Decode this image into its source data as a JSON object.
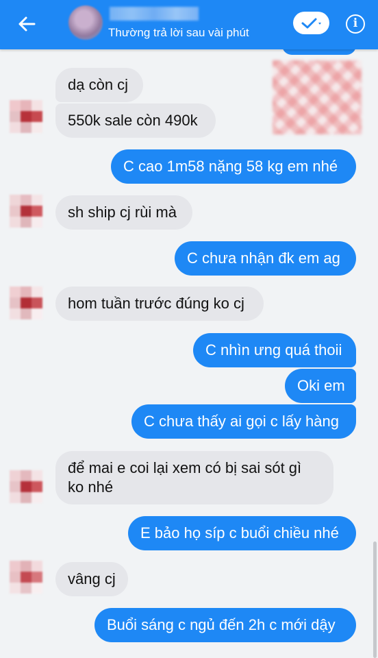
{
  "header": {
    "status_text": "Thường trả lời sau vài phút",
    "back_icon": "arrow-left-icon",
    "check_icon": "check-dropdown-icon",
    "info_icon": "info-icon",
    "info_glyph": "i"
  },
  "messages": [
    {
      "side": "in",
      "text": "dạ còn cj"
    },
    {
      "side": "in",
      "text": "550k sale còn 490k"
    },
    {
      "side": "out",
      "text": "C cao 1m58 nặng 58 kg em nhé"
    },
    {
      "side": "in",
      "text": "sh ship cj rùi mà"
    },
    {
      "side": "out",
      "text": "C chưa nhận đk em ag"
    },
    {
      "side": "in",
      "text": "hom tuần trước đúng ko cj"
    },
    {
      "side": "out",
      "text": "C nhìn ưng quá thoii"
    },
    {
      "side": "out",
      "text": "Oki em"
    },
    {
      "side": "out",
      "text": "C chưa thấy ai gọi c lấy hàng"
    },
    {
      "side": "in",
      "text": "để mai e coi lại xem có bị sai sót gì ko nhé"
    },
    {
      "side": "out",
      "text": "E bảo họ síp c buổi chiều nhé"
    },
    {
      "side": "in",
      "text": "vâng cj"
    },
    {
      "side": "out",
      "text": "Buổi sáng c ngủ đến 2h c mới dậy"
    }
  ],
  "colors": {
    "accent": "#1e88f5",
    "incoming_bubble": "#e5e6ea",
    "background": "#f1f3f5"
  }
}
